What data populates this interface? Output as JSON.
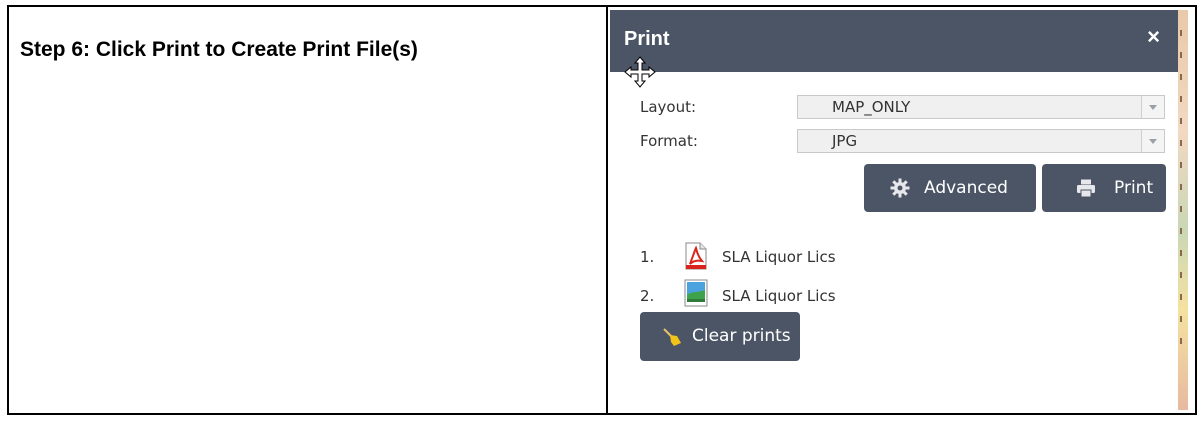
{
  "document": {
    "step_title": "Step 6: Click Print to Create Print File(s)"
  },
  "print_panel": {
    "title": "Print",
    "close_glyph": "×",
    "layout_label": "Layout:",
    "layout_value": "MAP_ONLY",
    "format_label": "Format:",
    "format_value": "JPG",
    "advanced_label": "Advanced",
    "print_label": "Print",
    "results": [
      {
        "index": "1.",
        "name": "SLA Liquor Lics",
        "icon": "pdf-file-icon"
      },
      {
        "index": "2.",
        "name": "SLA Liquor Lics",
        "icon": "image-file-icon"
      }
    ],
    "clear_label": "Clear prints"
  },
  "colors": {
    "header_bg": "#4c5566",
    "button_bg": "#4c5566",
    "pdf_red": "#d8261c"
  }
}
